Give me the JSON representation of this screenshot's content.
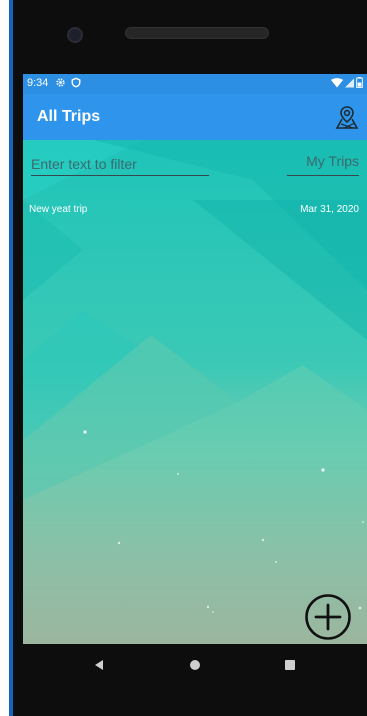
{
  "status_bar": {
    "time": "9:34",
    "left_icons": [
      "gear-icon",
      "shield-icon"
    ],
    "right_icons": [
      "wifi-icon",
      "signal-icon",
      "battery-icon"
    ]
  },
  "app_bar": {
    "title": "All Trips",
    "action_icon": "map-pin-icon"
  },
  "filter": {
    "placeholder": "Enter text to filter",
    "value": ""
  },
  "scope_label": "My Trips",
  "trips": [
    {
      "name": "New yeat trip",
      "date": "Mar 31, 2020"
    }
  ],
  "fab": {
    "icon": "plus-circle-icon"
  },
  "nav": {
    "back_icon": "back-triangle-icon",
    "home_icon": "home-circle-icon",
    "recents_icon": "recents-square-icon"
  },
  "colors": {
    "app_bar": "#2f95ec",
    "status_bar": "#2c8fe3",
    "bg_top": "#1ec6b9",
    "bg_bottom": "#e0998a"
  }
}
